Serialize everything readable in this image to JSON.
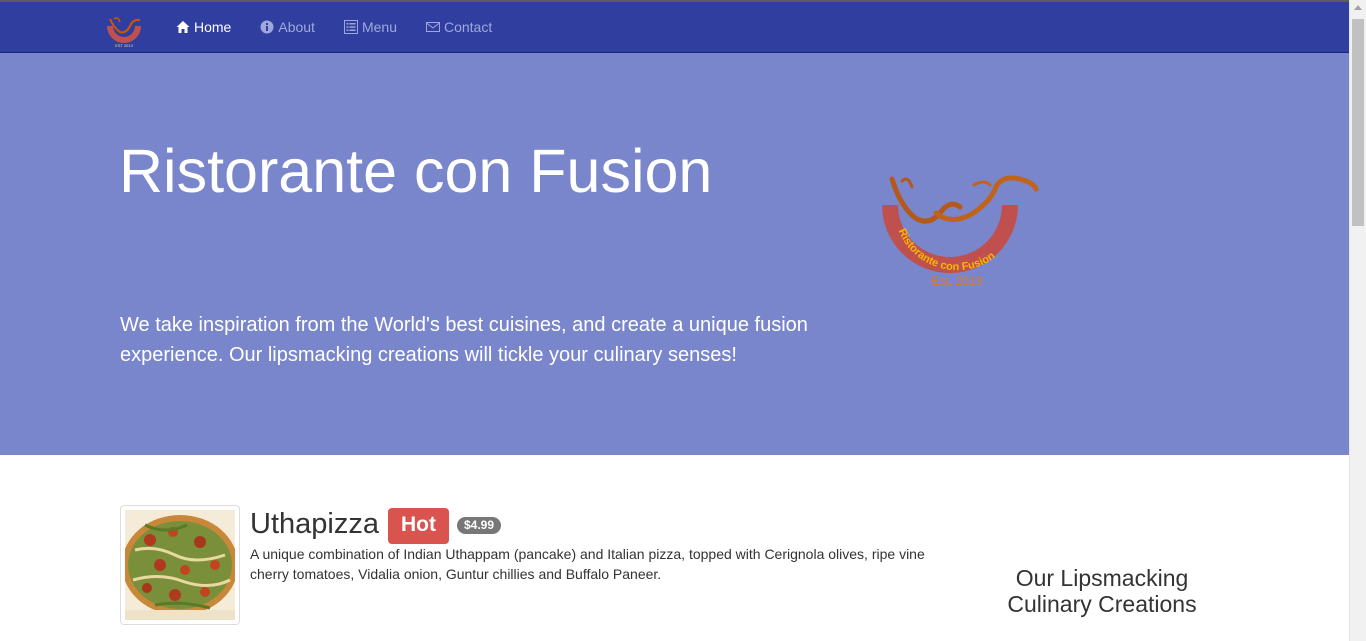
{
  "navbar": {
    "brand_logo_text": "Ristorante con Fusion",
    "items": [
      {
        "label": "Home",
        "icon": "home-icon",
        "active": true
      },
      {
        "label": "About",
        "icon": "info-icon",
        "active": false
      },
      {
        "label": "Menu",
        "icon": "list-icon",
        "active": false
      },
      {
        "label": "Contact",
        "icon": "envelope-icon",
        "active": false
      }
    ]
  },
  "jumbotron": {
    "title": "Ristorante con Fusion",
    "text": "We take inspiration from the World's best cuisines, and create a unique fusion experience. Our lipsmacking creations will tickle your culinary senses!",
    "logo": {
      "ring_text": "Ristorante con Fusion",
      "est_text": "Est. 2013"
    }
  },
  "featured_dish": {
    "name": "Uthapizza",
    "label": "Hot",
    "price": "$4.99",
    "description": "A unique combination of Indian Uthappam (pancake) and Italian pizza, topped with Cerignola olives, ripe vine cherry tomatoes, Vidalia onion, Guntur chillies and Buffalo Paneer."
  },
  "sidebar": {
    "heading": "Our Lipsmacking Culinary Creations"
  },
  "colors": {
    "navbar": "#303f9f",
    "jumbotron": "#7986cb",
    "label_hot": "#d9534f",
    "badge": "#777777",
    "logo_red": "#c0504d",
    "logo_orange": "#e07b1a"
  }
}
